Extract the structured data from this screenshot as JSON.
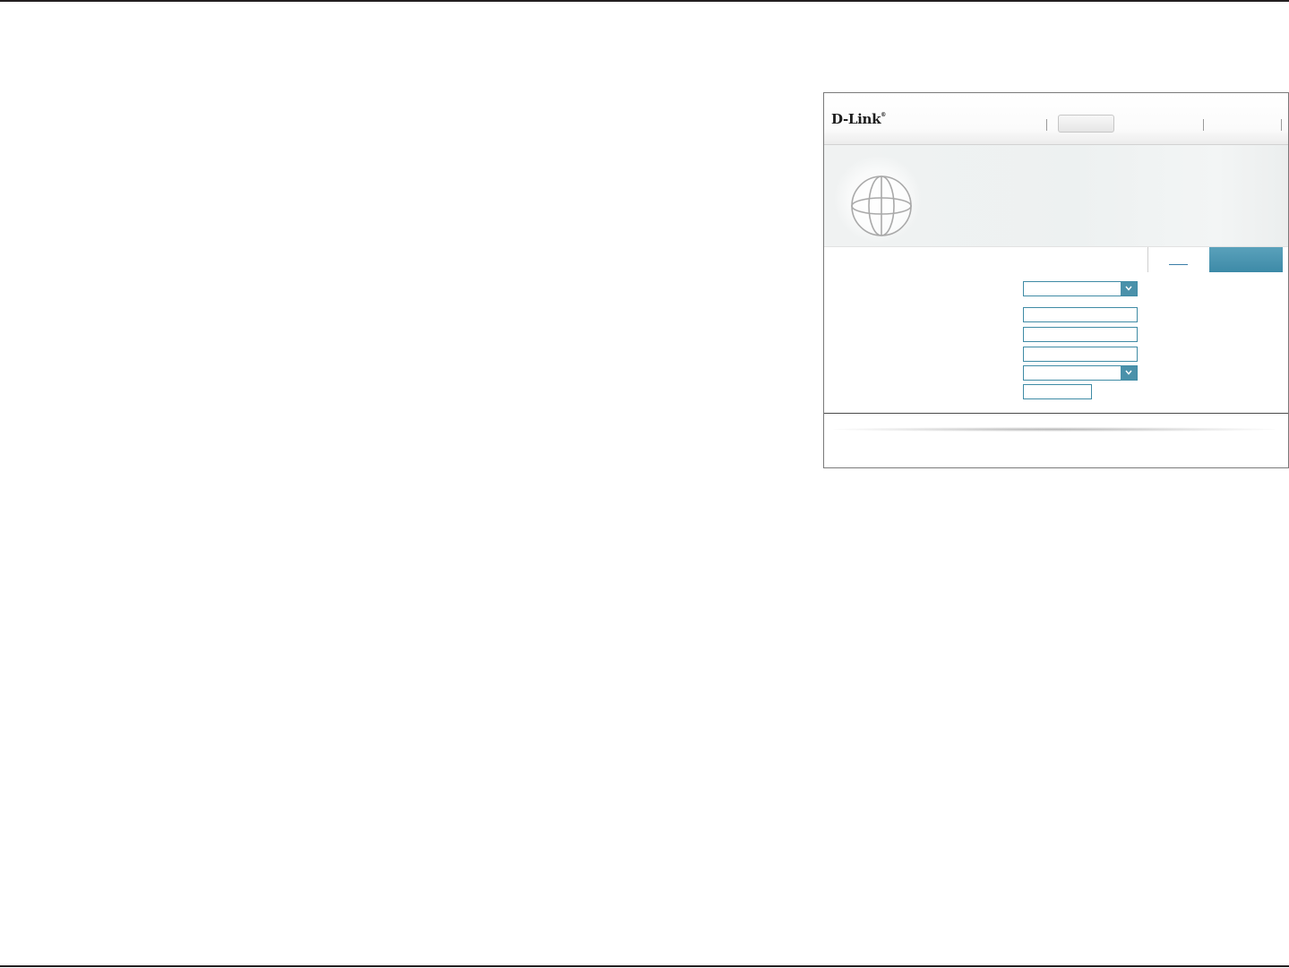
{
  "brand": {
    "logo_text": "D-Link",
    "logo_mark": "®"
  },
  "nav": {
    "tabs": [
      {
        "label": "",
        "active": true
      }
    ]
  },
  "banner": {
    "icon": "globe-icon"
  },
  "actions": {
    "link_label": "",
    "primary_label": ""
  },
  "form": {
    "fields": [
      {
        "type": "select",
        "value": ""
      },
      {
        "type": "text",
        "value": ""
      },
      {
        "type": "text",
        "value": ""
      },
      {
        "type": "text",
        "value": ""
      },
      {
        "type": "select",
        "value": ""
      },
      {
        "type": "text",
        "value": ""
      }
    ]
  },
  "colors": {
    "accent": "#4a91aa",
    "frame_border": "#7a7a7a",
    "page_rule": "#231f20"
  }
}
